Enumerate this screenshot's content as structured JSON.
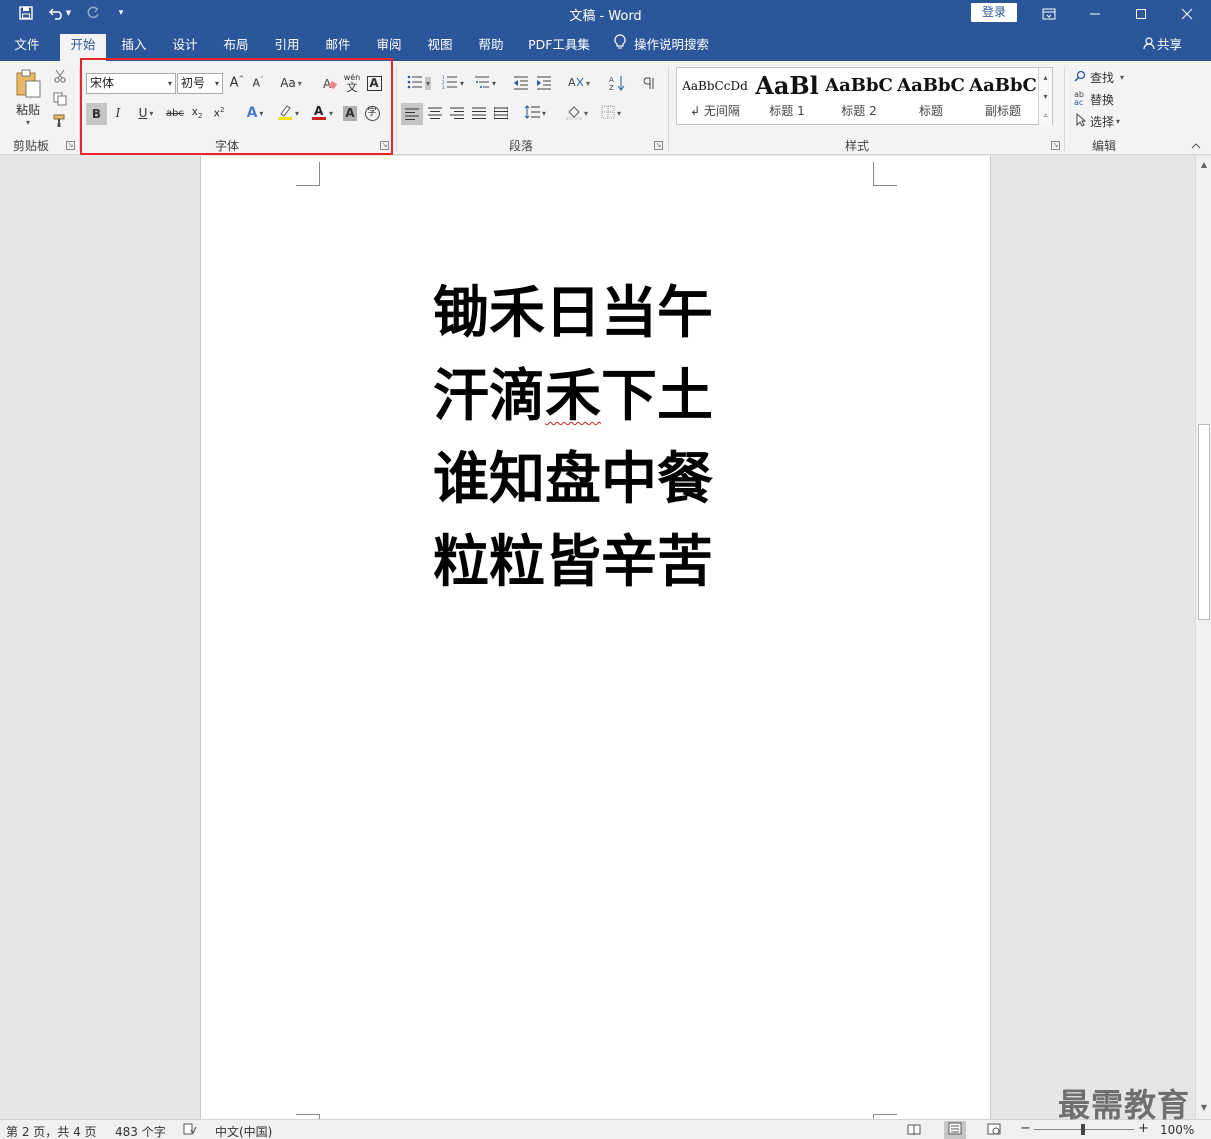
{
  "titlebar": {
    "doc_title": "文稿 - Word",
    "login": "登录",
    "qat": {
      "save_icon": "save-icon",
      "undo_icon": "undo-icon",
      "redo_icon": "redo-icon",
      "customize_icon": "customize-qat-icon"
    }
  },
  "tabs": [
    {
      "label": "文件"
    },
    {
      "label": "开始"
    },
    {
      "label": "插入"
    },
    {
      "label": "设计"
    },
    {
      "label": "布局"
    },
    {
      "label": "引用"
    },
    {
      "label": "邮件"
    },
    {
      "label": "审阅"
    },
    {
      "label": "视图"
    },
    {
      "label": "帮助"
    },
    {
      "label": "PDF工具集"
    }
  ],
  "active_tab": "开始",
  "tell_me": "操作说明搜索",
  "share": "共享",
  "ribbon": {
    "clipboard": {
      "label": "剪贴板",
      "paste": "粘贴"
    },
    "font": {
      "label": "字体",
      "font_name": "宋体",
      "font_size": "初号",
      "change_case": "Aa",
      "strikethrough": "abc",
      "phonetic_top": "wén",
      "phonetic_bottom": "文"
    },
    "paragraph": {
      "label": "段落"
    },
    "styles": {
      "label": "样式",
      "items": [
        {
          "sample": "AaBbCcDd",
          "name": "↲ 无间隔"
        },
        {
          "sample": "AaBl",
          "name": "标题 1"
        },
        {
          "sample": "AaBbC",
          "name": "标题 2"
        },
        {
          "sample": "AaBbC",
          "name": "标题"
        },
        {
          "sample": "AaBbC",
          "name": "副标题"
        }
      ]
    },
    "editing": {
      "label": "编辑",
      "find": "查找",
      "replace": "替换",
      "select": "选择"
    }
  },
  "document": {
    "lines": [
      "锄禾日当午",
      "汗滴禾下土",
      "谁知盘中餐",
      "粒粒皆辛苦"
    ],
    "spell_flag_line2": {
      "before": "汗滴",
      "flagged": "禾",
      "after": "下土"
    }
  },
  "statusbar": {
    "page": "第 2 页，共 4 页",
    "words": "483 个字",
    "language": "中文(中国)",
    "zoom_minus": "−",
    "zoom_plus": "+",
    "zoom": "100%"
  },
  "watermark": "最需教育",
  "colors": {
    "accent": "#2b579a",
    "highlight_box": "#e8262b",
    "font_color_bar": "#d02020",
    "highlight_color_bar": "#f7e600"
  }
}
